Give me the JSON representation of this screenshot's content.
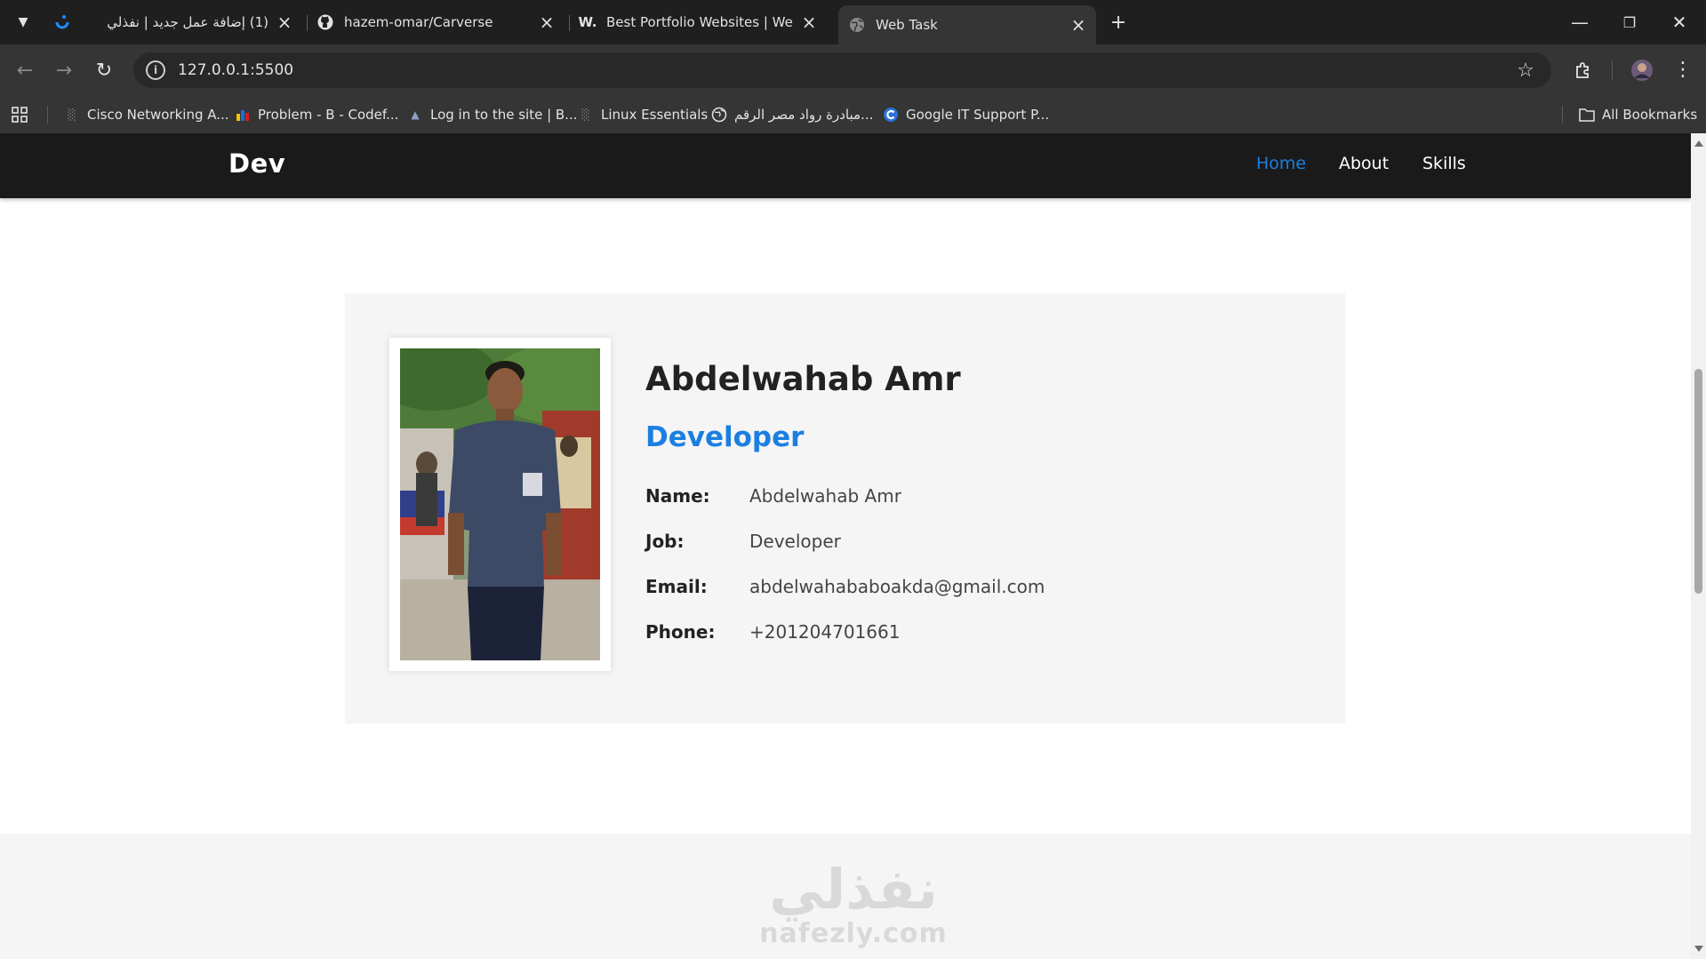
{
  "browser": {
    "tabs": [
      {
        "title": "(1) إضافة عمل جديد | نفذلي",
        "favicon": "nafezly-icon"
      },
      {
        "title": "hazem-omar/Carverse",
        "favicon": "github-icon"
      },
      {
        "title": "Best Portfolio Websites | Web D",
        "favicon": "webflow-w-icon"
      },
      {
        "title": "Web Task",
        "favicon": "globe-icon",
        "active": true
      }
    ],
    "url": "127.0.0.1:5500",
    "bookmarks": [
      {
        "label": "Cisco Networking A...",
        "icon": "cisco-icon"
      },
      {
        "label": "Problem - B - Codef...",
        "icon": "codeforces-icon"
      },
      {
        "label": "Log in to the site | B...",
        "icon": "moodle-icon"
      },
      {
        "label": "Linux Essentials",
        "icon": "cisco-icon"
      },
      {
        "label": "مبادرة رواد مصر الرقم...",
        "icon": "globe-icon"
      },
      {
        "label": "Google IT Support P...",
        "icon": "coursera-icon"
      }
    ],
    "all_bookmarks": "All Bookmarks"
  },
  "site": {
    "logo": "Dev",
    "nav": [
      {
        "label": "Home",
        "active": true
      },
      {
        "label": "About",
        "active": false
      },
      {
        "label": "Skills",
        "active": false
      }
    ],
    "accent_color": "#1a7fe0"
  },
  "profile": {
    "name": "Abdelwahab Amr",
    "role": "Developer",
    "fields": [
      {
        "label": "Name:",
        "value": "Abdelwahab Amr"
      },
      {
        "label": "Job:",
        "value": "Developer"
      },
      {
        "label": "Email:",
        "value": "abdelwahababoakda@gmail.com"
      },
      {
        "label": "Phone:",
        "value": "+201204701661"
      }
    ]
  },
  "watermark": {
    "arabic": "نفذلي",
    "latin": "nafezly.com"
  }
}
